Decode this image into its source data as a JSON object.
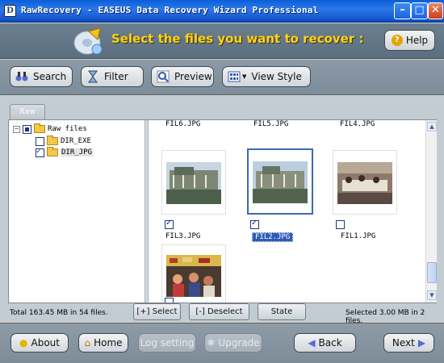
{
  "window": {
    "title": "RawRecovery - EASEUS Data Recovery Wizard Professional",
    "app_icon_letter": "D"
  },
  "banner": {
    "heading": "Select the files you want to recover :",
    "help_label": "Help"
  },
  "toolbar": {
    "search": "Search",
    "filter": "Filter",
    "preview": "Preview",
    "view_style": "View Style"
  },
  "tab": {
    "label": "Raw"
  },
  "tree": {
    "root": "Raw files",
    "children": [
      {
        "label": "DIR_EXE",
        "checked": false
      },
      {
        "label": "DIR_JPG",
        "checked": true
      }
    ]
  },
  "files": {
    "top_row": [
      "FIL6.JPG",
      "FIL5.JPG",
      "FIL4.JPG"
    ],
    "items": [
      {
        "name": "FIL3.JPG",
        "checked": true
      },
      {
        "name": "FIL2.JPG",
        "checked": true,
        "selected": true
      },
      {
        "name": "FIL1.JPG",
        "checked": false
      },
      {
        "name": "",
        "checked": false
      }
    ]
  },
  "status": {
    "total": "Total 163.45 MB in 54 files.",
    "selected": "Selected 3.00 MB in 2 files.",
    "select_btn": "[+] Select",
    "deselect_btn": "[-] Deselect",
    "state_btn": "State"
  },
  "bottom": {
    "about": "About",
    "home": "Home",
    "log_setting": "Log setting",
    "upgrade": "Upgrade",
    "back": "Back",
    "next": "Next"
  }
}
